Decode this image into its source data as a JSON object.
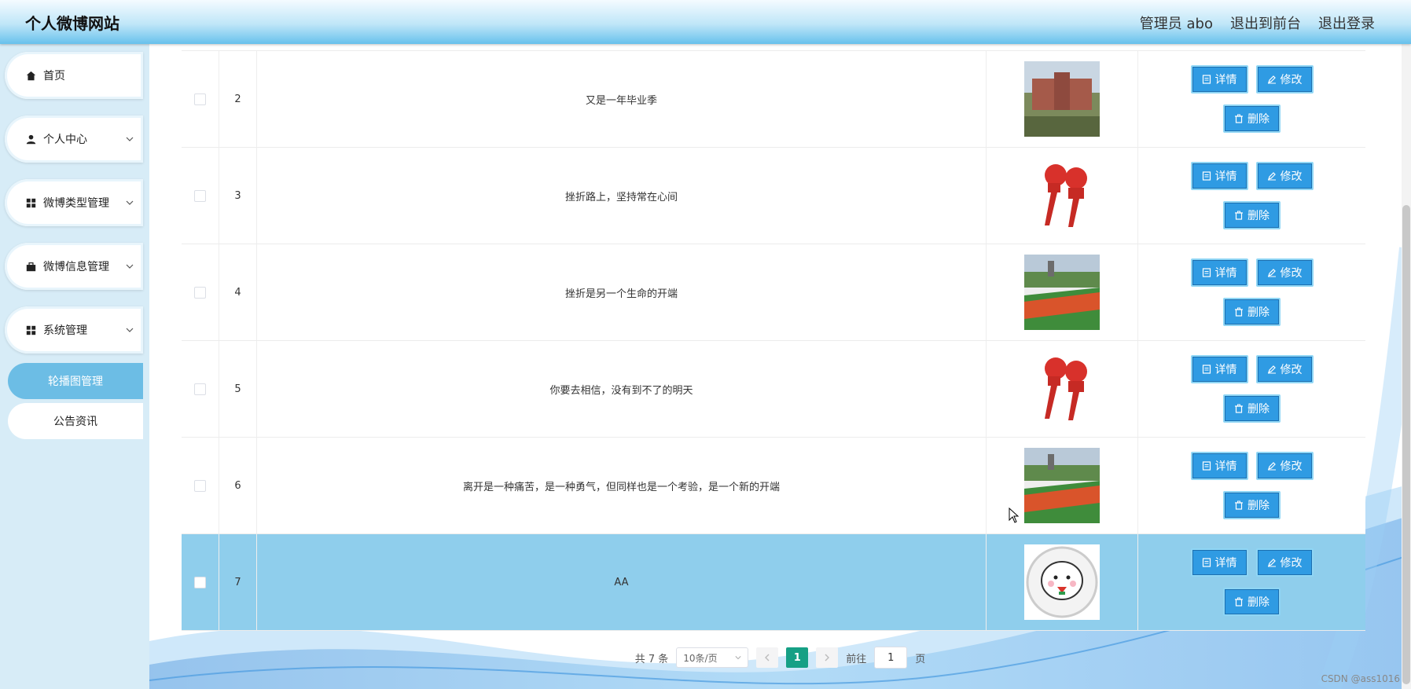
{
  "header": {
    "title": "个人微博网站",
    "nav": [
      "管理员 abo",
      "退出到前台",
      "退出登录"
    ]
  },
  "sidebar": {
    "items": [
      {
        "label": "首页",
        "icon": "home-icon"
      },
      {
        "label": "个人中心",
        "icon": "user-icon"
      },
      {
        "label": "微博类型管理",
        "icon": "grid-icon"
      },
      {
        "label": "微博信息管理",
        "icon": "briefcase-icon"
      },
      {
        "label": "系统管理",
        "icon": "grid-icon"
      }
    ],
    "subitems": [
      {
        "label": "轮播图管理",
        "active": true
      },
      {
        "label": "公告资讯",
        "active": false
      }
    ]
  },
  "table": {
    "rows": [
      {
        "index": "2",
        "title": "又是一年毕业季",
        "image": "campus-building"
      },
      {
        "index": "3",
        "title": "挫折路上，坚持常在心间",
        "image": "live-microphones"
      },
      {
        "index": "4",
        "title": "挫折是另一个生命的开端",
        "image": "sports-field"
      },
      {
        "index": "5",
        "title": "你要去相信，没有到不了的明天",
        "image": "live-microphones"
      },
      {
        "index": "6",
        "title": "离开是一种痛苦，是一种勇气，但同样也是一个考验，是一个新的开端",
        "image": "sports-field"
      },
      {
        "index": "7",
        "title": "AA",
        "image": "cartoon-face",
        "selected": true
      }
    ],
    "actions": {
      "detail": "详情",
      "edit": "修改",
      "delete": "删除"
    }
  },
  "pagination": {
    "total_label": "共 7 条",
    "page_size": "10条/页",
    "current_page": "1",
    "goto_label": "前往",
    "goto_value": "1",
    "page_unit": "页"
  },
  "watermark": "CSDN @ass1016",
  "colors": {
    "header_bottom": "#67c1ec",
    "button_blue": "#2f9be3",
    "active_menu": "#6cbde5",
    "selected_row": "#8fceec",
    "page_active": "#16a085"
  }
}
